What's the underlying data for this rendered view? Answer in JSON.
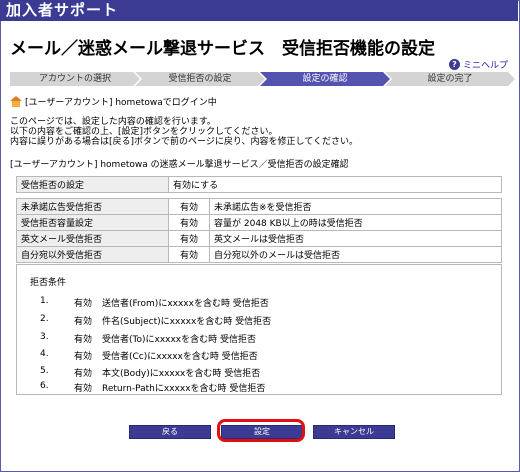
{
  "header": {
    "brand": "加入者サポート"
  },
  "page": {
    "title": "メール／迷惑メール撃退サービス　受信拒否機能の設定"
  },
  "help": {
    "label": "ミニヘルプ"
  },
  "steps": [
    {
      "label": "アカウントの選択"
    },
    {
      "label": "受信拒否の設定"
    },
    {
      "label": "設定の確認"
    },
    {
      "label": "設定の完了"
    }
  ],
  "login": {
    "text": "[ユーザーアカウント] hometowaでログイン中"
  },
  "intro": {
    "line1": "このページでは、設定した内容の確認を行います。",
    "line2": "以下の内容をご確認の上、[設定]ボタンをクリックしてください。",
    "line3": "内容に誤りがある場合は[戻る]ボタンで前のページに戻り、内容を修正してください。"
  },
  "section": {
    "title": "[ユーザーアカウント] hometowa の迷惑メール撃退サービス／受信拒否の設定確認"
  },
  "setting": {
    "label": "受信拒否の設定",
    "value": "有効にする"
  },
  "rules": [
    {
      "label": "未承諾広告受信拒否",
      "status": "有効",
      "desc": "未承諾広告※を受信拒否"
    },
    {
      "label": "受信拒否容量設定",
      "status": "有効",
      "desc": "容量が 2048 KB以上の時は受信拒否"
    },
    {
      "label": "英文メール受信拒否",
      "status": "有効",
      "desc": "英文メールは受信拒否"
    },
    {
      "label": "自分宛以外受信拒否",
      "status": "有効",
      "desc": "自分宛以外のメールは受信拒否"
    }
  ],
  "conditions": {
    "title": "拒否条件",
    "items": [
      {
        "num": "1.",
        "status": "有効",
        "text": "送信者(From)にxxxxxを含む時 受信拒否"
      },
      {
        "num": "2.",
        "status": "有効",
        "text": "件名(Subject)にxxxxxを含む時 受信拒否"
      },
      {
        "num": "3.",
        "status": "有効",
        "text": "受信者(To)にxxxxxを含む時 受信拒否"
      },
      {
        "num": "4.",
        "status": "有効",
        "text": "受信者(Cc)にxxxxxを含む時 受信拒否"
      },
      {
        "num": "5.",
        "status": "有効",
        "text": "本文(Body)にxxxxxを含む時 受信拒否"
      },
      {
        "num": "6.",
        "status": "有効",
        "text": "Return-Pathにxxxxxを含む時 受信拒否"
      }
    ]
  },
  "buttons": {
    "back": "戻る",
    "submit": "設定",
    "cancel": "キャンセル"
  },
  "colors": {
    "brand": "#3b3b94",
    "active_step": "#5454b0",
    "highlight": "#e01010"
  }
}
